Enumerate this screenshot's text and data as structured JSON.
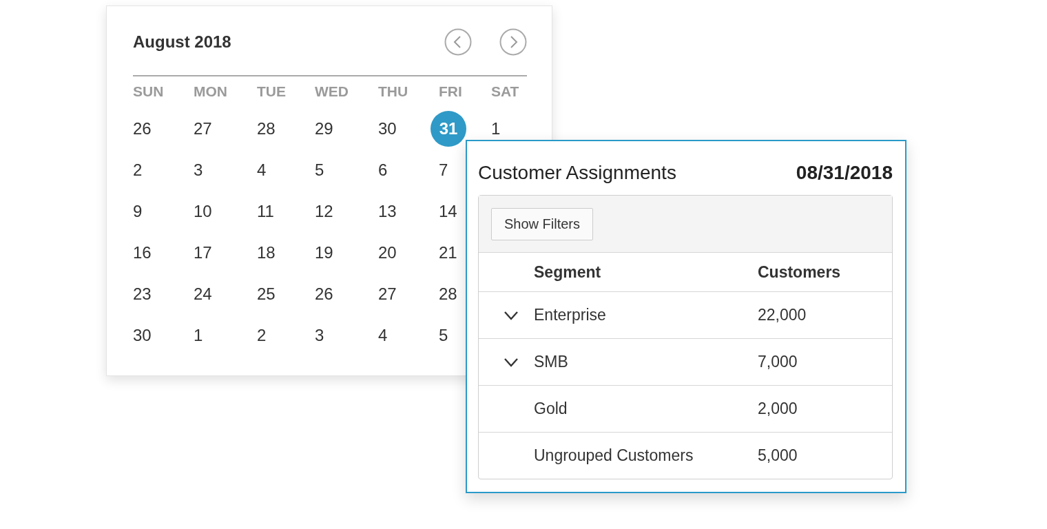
{
  "calendar": {
    "title": "August 2018",
    "weekdays": [
      "SUN",
      "MON",
      "TUE",
      "WED",
      "THU",
      "FRI",
      "SAT"
    ],
    "weeks": [
      [
        {
          "label": "26",
          "selected": false
        },
        {
          "label": "27",
          "selected": false
        },
        {
          "label": "28",
          "selected": false
        },
        {
          "label": "29",
          "selected": false
        },
        {
          "label": "30",
          "selected": false
        },
        {
          "label": "31",
          "selected": true
        },
        {
          "label": "1",
          "selected": false
        }
      ],
      [
        {
          "label": "2",
          "selected": false
        },
        {
          "label": "3",
          "selected": false
        },
        {
          "label": "4",
          "selected": false
        },
        {
          "label": "5",
          "selected": false
        },
        {
          "label": "6",
          "selected": false
        },
        {
          "label": "7",
          "selected": false
        }
      ],
      [
        {
          "label": "9",
          "selected": false
        },
        {
          "label": "10",
          "selected": false
        },
        {
          "label": "11",
          "selected": false
        },
        {
          "label": "12",
          "selected": false
        },
        {
          "label": "13",
          "selected": false
        },
        {
          "label": "14",
          "selected": false
        }
      ],
      [
        {
          "label": "16",
          "selected": false
        },
        {
          "label": "17",
          "selected": false
        },
        {
          "label": "18",
          "selected": false
        },
        {
          "label": "19",
          "selected": false
        },
        {
          "label": "20",
          "selected": false
        },
        {
          "label": "21",
          "selected": false
        }
      ],
      [
        {
          "label": "23",
          "selected": false
        },
        {
          "label": "24",
          "selected": false
        },
        {
          "label": "25",
          "selected": false
        },
        {
          "label": "26",
          "selected": false
        },
        {
          "label": "27",
          "selected": false
        },
        {
          "label": "28",
          "selected": false
        }
      ],
      [
        {
          "label": "30",
          "selected": false
        },
        {
          "label": "1",
          "selected": false
        },
        {
          "label": "2",
          "selected": false
        },
        {
          "label": "3",
          "selected": false
        },
        {
          "label": "4",
          "selected": false
        },
        {
          "label": "5",
          "selected": false
        }
      ]
    ]
  },
  "panel": {
    "title": "Customer Assignments",
    "date": "08/31/2018",
    "filter_button": "Show Filters",
    "table": {
      "columns": [
        "Segment",
        "Customers"
      ],
      "rows": [
        {
          "kind": "group",
          "expanded": true,
          "segment": "Enterprise",
          "customers": "22,000"
        },
        {
          "kind": "group",
          "expanded": true,
          "segment": "SMB",
          "customers": "7,000"
        },
        {
          "kind": "item",
          "segment": "Gold",
          "customers": "2,000"
        },
        {
          "kind": "item",
          "segment": "Ungrouped Customers",
          "customers": "5,000"
        }
      ]
    }
  }
}
